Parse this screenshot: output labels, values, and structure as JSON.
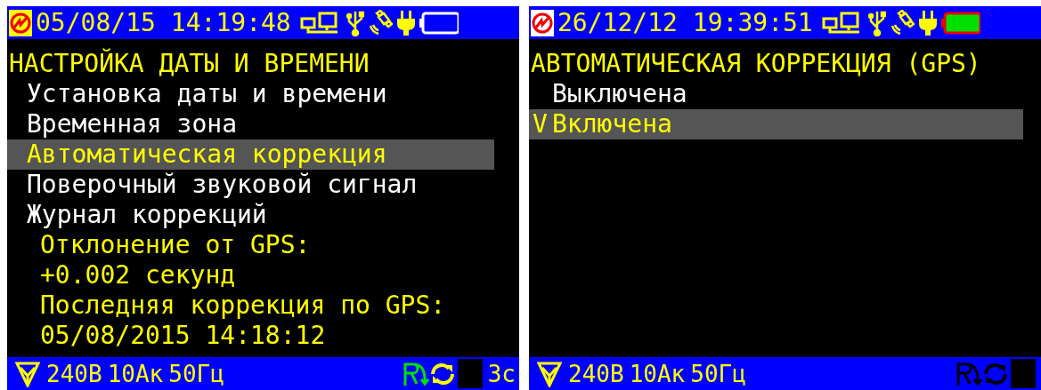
{
  "screens": [
    {
      "header": {
        "logo_highlighted": true,
        "date": "05/08/15",
        "time": "14:19:48",
        "battery": {
          "kind": "empty"
        }
      },
      "title": "НАСТРОЙКА ДАТЫ И ВРЕМЕНИ",
      "items": [
        {
          "kind": "menu",
          "label": "Установка даты и времени",
          "selected": false
        },
        {
          "kind": "menu",
          "label": "Временная зона",
          "selected": false
        },
        {
          "kind": "menu",
          "label": "Автоматическая коррекция",
          "selected": true
        },
        {
          "kind": "menu",
          "label": "Поверочный звуковой сигнал",
          "selected": false
        },
        {
          "kind": "menu",
          "label": "Журнал коррекций",
          "selected": false
        },
        {
          "kind": "info",
          "label": "Отклонение от GPS:"
        },
        {
          "kind": "info",
          "label": "+0.002 секунд"
        },
        {
          "kind": "info",
          "label": "Последняя коррекция по GPS:"
        },
        {
          "kind": "info",
          "label": "05/08/2015 14:18:12"
        }
      ],
      "footer": {
        "voltage": "240В",
        "current": "10Ак",
        "frequency": "50Гц",
        "icons_active": true,
        "timer": "3с"
      }
    },
    {
      "header": {
        "logo_highlighted": false,
        "date": "26/12/12",
        "time": "19:39:51",
        "battery": {
          "kind": "full"
        }
      },
      "title": "АВТОМАТИЧЕСКАЯ КОРРЕКЦИЯ (GPS)",
      "check_mark": "V",
      "items": [
        {
          "kind": "option",
          "label": "Выключена",
          "checked": false,
          "selected": false
        },
        {
          "kind": "option",
          "label": "Включена",
          "checked": true,
          "selected": true
        }
      ],
      "footer": {
        "voltage": "240В",
        "current": "10Ак",
        "frequency": "50Гц",
        "icons_active": false
      }
    }
  ]
}
